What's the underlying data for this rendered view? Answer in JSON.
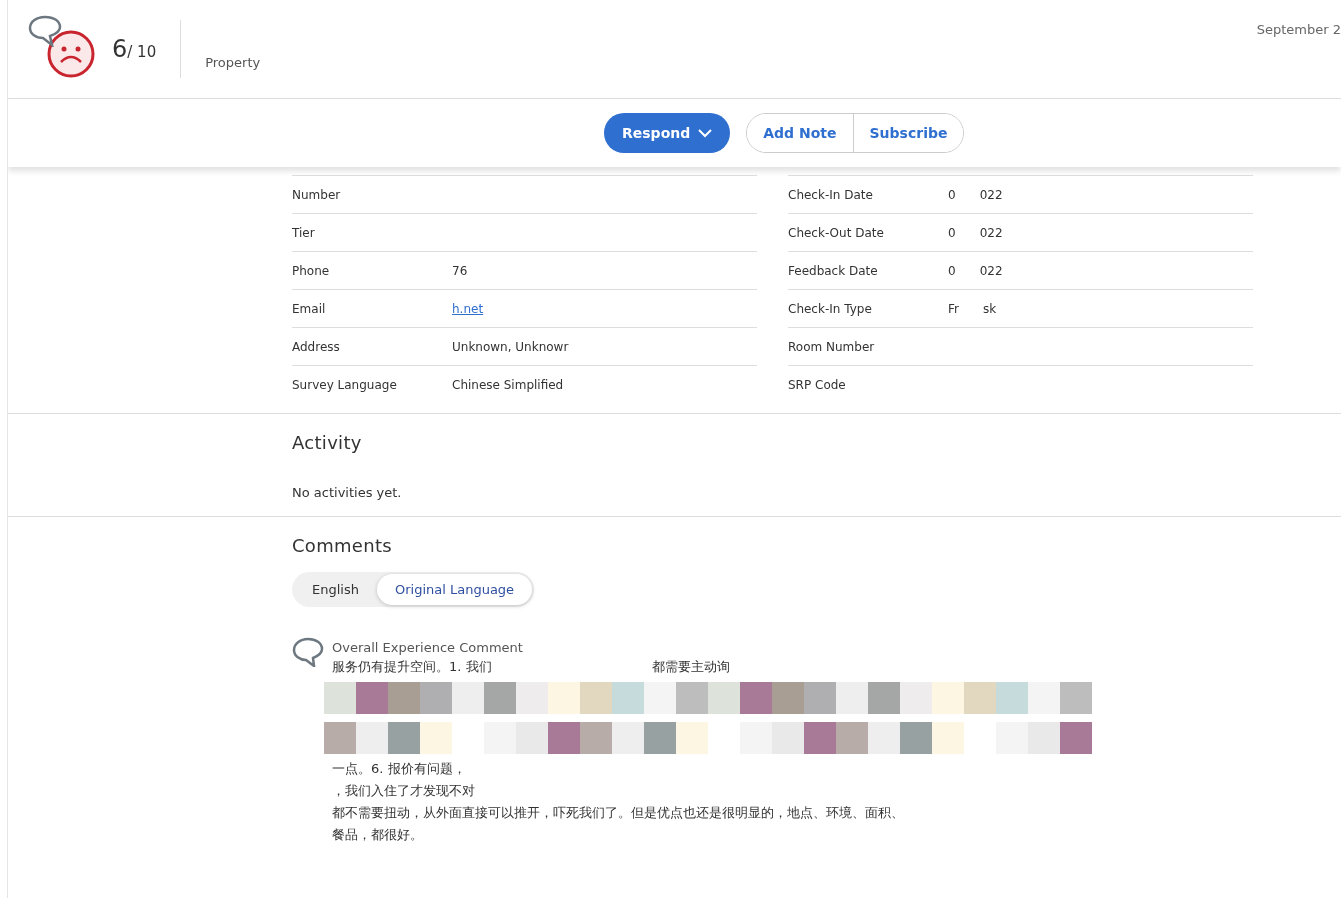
{
  "header": {
    "score": "6",
    "score_max": "/ 10",
    "property_label": "Property",
    "date": "September 2"
  },
  "toolbar": {
    "respond": "Respond",
    "actions": [
      "Add Note",
      "Subscribe"
    ]
  },
  "details": {
    "left": [
      {
        "label": "Number"
      },
      {
        "label": "Tier"
      },
      {
        "label": "Phone",
        "parts": [
          "76"
        ]
      },
      {
        "label": "Email",
        "parts": [
          "h.net"
        ],
        "kind": "link"
      },
      {
        "label": "Address",
        "parts": [
          "Unknown, Unknowr"
        ]
      },
      {
        "label": "Survey Language",
        "parts": [
          "Chinese Simplified"
        ]
      }
    ],
    "right": [
      {
        "label": "Check-In Date",
        "parts": [
          "0",
          "022"
        ]
      },
      {
        "label": "Check-Out Date",
        "parts": [
          "0",
          "022"
        ]
      },
      {
        "label": "Feedback Date",
        "parts": [
          "0",
          "022"
        ]
      },
      {
        "label": "Check-In Type",
        "parts": [
          "Fr",
          "sk"
        ]
      },
      {
        "label": "Room Number"
      },
      {
        "label": "SRP Code"
      }
    ]
  },
  "activity": {
    "title": "Activity",
    "empty": "No activities yet."
  },
  "comments": {
    "title": "Comments",
    "languages": [
      {
        "label": "English",
        "selected": false
      },
      {
        "label": "Original Language",
        "selected": true
      }
    ],
    "comment": {
      "title": "Overall Experience Comment",
      "lines": [
        {
          "parts": [
            "服务仍有提升空间。1. 我们",
            "都需要主动询"
          ]
        },
        {
          "kind": "mosaic"
        },
        {
          "kind": "mosaic"
        },
        {
          "parts": [
            "一点。6. 报价有问题，"
          ]
        },
        {
          "parts": [
            "，我们入住了才发现不对"
          ]
        },
        {
          "parts": [
            "都不需要扭动，从外面直接可以推开，吓死我们了。但是优点也还是很明显的，地点、环境、面积、"
          ]
        },
        {
          "parts": [
            "餐品，都很好。"
          ]
        }
      ]
    }
  }
}
